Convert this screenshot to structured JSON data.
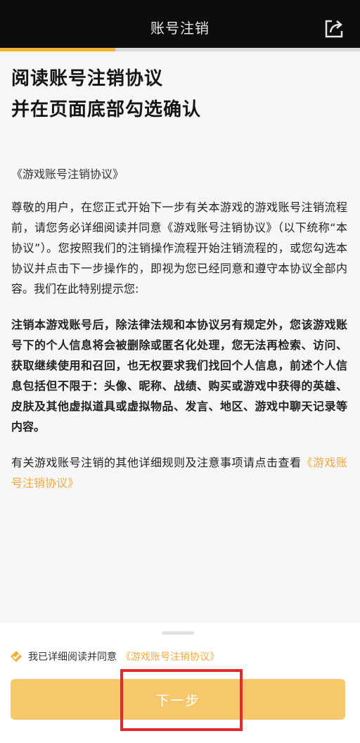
{
  "header": {
    "title": "账号注销",
    "share_icon": "share-icon"
  },
  "progress": {
    "fraction": 0.32
  },
  "heading": {
    "line1": "阅读账号注销协议",
    "line2": "并在页面底部勾选确认"
  },
  "document": {
    "title": "《游戏账号注销协议》",
    "para1": "尊敬的用户，在您正式开始下一步有关本游戏的游戏账号注销流程前，请您务必详细阅读并同意《游戏账号注销协议》（以下统称“本协议”）。您按照我们的注销操作流程开始注销流程的，或您勾选本协议并点击下一步操作的，即视为您已经同意和遵守本协议全部内容。我们在此特别提示您:",
    "para2": "注销本游戏账号后，除法律法规和本协议另有规定外，您该游戏账号下的个人信息将会被删除或匿名化处理，您无法再检索、访问、获取继续使用和召回，也无权要求我们找回个人信息，前述个人信息包括但不限于：头像、昵称、战绩、购买或游戏中获得的英雄、皮肤及其他虚拟道具或虚拟物品、发言、地区、游戏中聊天记录等内容。",
    "para3_text": "有关游戏账号注销的其他详细规则及注意事项请点击查看",
    "para3_link": "《游戏账号注销协议》"
  },
  "footer": {
    "agree_text": "我已详细阅读并同意",
    "agree_link": "《游戏账号注销协议》",
    "next_label": "下一步"
  },
  "colors": {
    "accent": "#f3b235",
    "link": "#f0a93a",
    "button": "#f7c76c",
    "highlight": "#e6292b"
  }
}
